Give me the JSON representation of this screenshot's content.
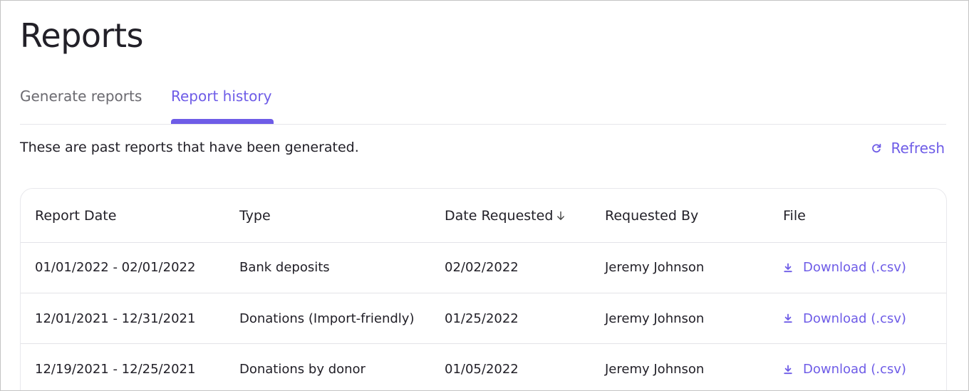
{
  "page": {
    "title": "Reports",
    "tabs": [
      {
        "label": "Generate reports",
        "active": false
      },
      {
        "label": "Report history",
        "active": true
      }
    ],
    "description": "These are past reports that have been generated.",
    "refresh_label": "Refresh"
  },
  "table": {
    "columns": [
      "Report Date",
      "Type",
      "Date Requested",
      "Requested By",
      "File"
    ],
    "sorted_column": "Date Requested",
    "sort_direction": "descending",
    "rows": [
      {
        "report_date": "01/01/2022 - 02/01/2022",
        "type": "Bank deposits",
        "date_requested": "02/02/2022",
        "requested_by": "Jeremy Johnson",
        "file": "Download (.csv)"
      },
      {
        "report_date": "12/01/2021 - 12/31/2021",
        "type": "Donations (Import-friendly)",
        "date_requested": "01/25/2022",
        "requested_by": "Jeremy Johnson",
        "file": "Download (.csv)"
      },
      {
        "report_date": "12/19/2021 - 12/25/2021",
        "type": "Donations by donor",
        "date_requested": "01/05/2022",
        "requested_by": "Jeremy Johnson",
        "file": "Download (.csv)"
      }
    ]
  },
  "colors": {
    "accent": "#6e5ce7",
    "text": "#222028",
    "muted": "#6b6a70"
  },
  "icons": {
    "refresh": "refresh-icon",
    "sort": "arrow-down-icon",
    "download": "download-icon"
  }
}
